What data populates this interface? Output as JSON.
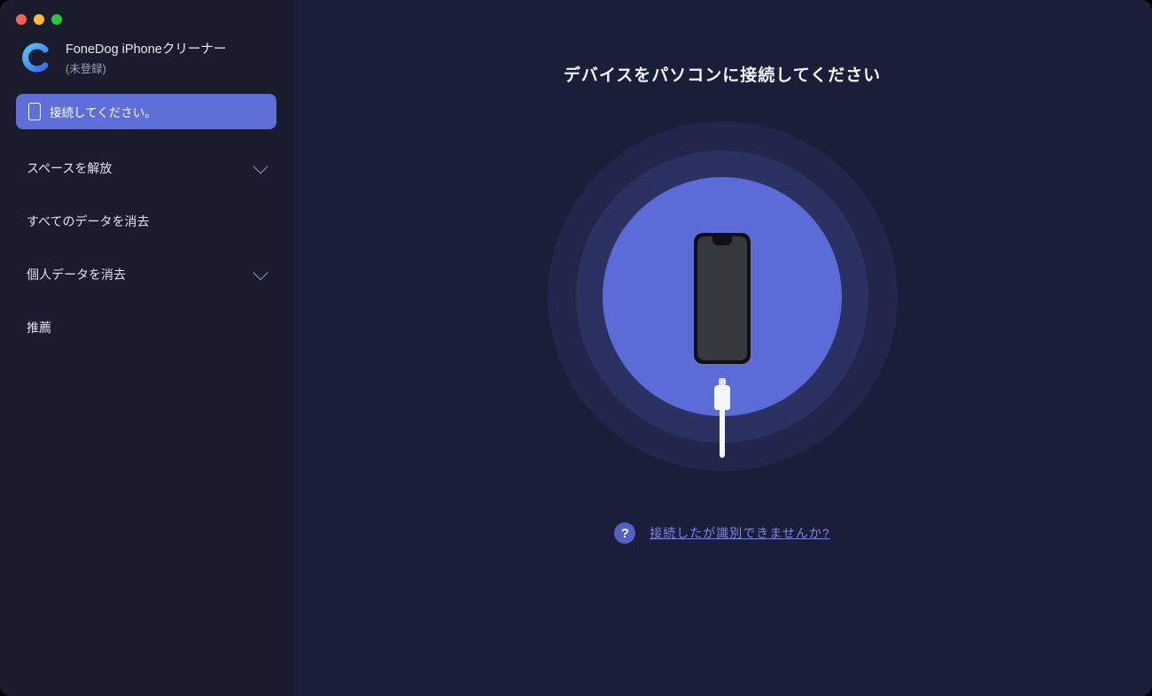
{
  "app": {
    "title": "FoneDog iPhoneクリーナー",
    "subtitle": "(未登録)"
  },
  "sidebar": {
    "active_label": "接続してください。",
    "items": [
      {
        "label": "スペースを解放",
        "has_children": true
      },
      {
        "label": "すべてのデータを消去",
        "has_children": false
      },
      {
        "label": "個人データを消去",
        "has_children": true
      },
      {
        "label": "推薦",
        "has_children": false
      }
    ]
  },
  "main": {
    "title": "デバイスをパソコンに接続してください",
    "help_text": "接続したが識別できませんか?"
  }
}
